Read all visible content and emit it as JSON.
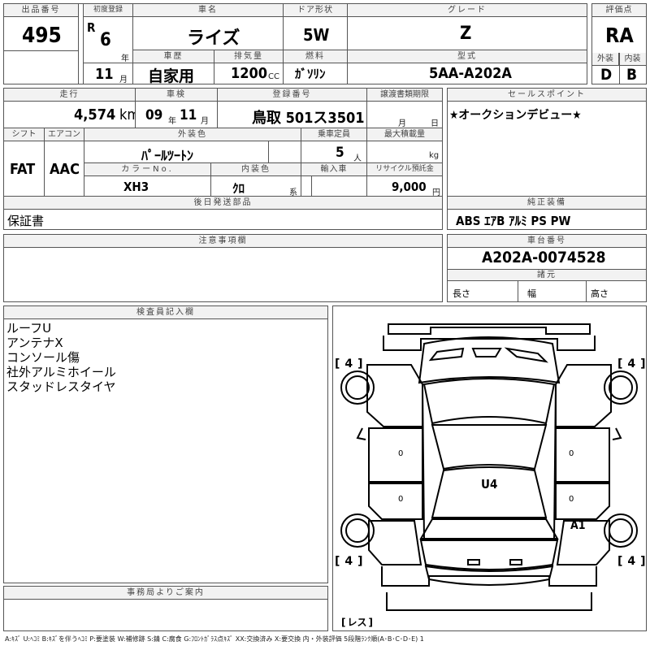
{
  "lot": {
    "label": "出品番号",
    "value": "495"
  },
  "reg": {
    "label": "初度登録",
    "era": "R",
    "year": "6",
    "year_unit": "年",
    "month": "11",
    "month_unit": "月"
  },
  "car_name": {
    "label": "車名",
    "value": "ライズ"
  },
  "door": {
    "label": "ドア形状",
    "value": "5W"
  },
  "grade": {
    "label": "グレード",
    "value": "Z"
  },
  "score": {
    "label": "評価点",
    "value": "RA"
  },
  "history": {
    "label": "車歴",
    "value": "自家用"
  },
  "displacement": {
    "label": "排気量",
    "value": "1200",
    "unit": "CC"
  },
  "fuel": {
    "label": "燃料",
    "value": "ｶﾞｿﾘﾝ"
  },
  "model": {
    "label": "型式",
    "value": "5AA-A202A"
  },
  "exterior_grade": {
    "label": "外装",
    "value": "D"
  },
  "interior_grade": {
    "label": "内装",
    "value": "B"
  },
  "mileage": {
    "label": "走行",
    "value": "4,574",
    "unit": "km"
  },
  "inspection": {
    "label": "車検",
    "year": "09",
    "year_unit": "年",
    "month": "11",
    "month_unit": "月"
  },
  "plate": {
    "label": "登録番号",
    "value": "鳥取 501ス3501"
  },
  "transfer": {
    "label": "譲渡書類期限",
    "month_unit": "月",
    "day_unit": "日"
  },
  "sales_point": {
    "label": "セールスポイント",
    "value": "★オークションデビュー★"
  },
  "shift": {
    "label": "シフト",
    "value": "FAT"
  },
  "aircon": {
    "label": "エアコン",
    "value": "AAC"
  },
  "ext_color": {
    "label": "外装色",
    "value": "ﾊﾟｰﾙﾂｰﾄﾝ"
  },
  "capacity": {
    "label": "乗車定員",
    "value": "5",
    "unit": "人"
  },
  "max_load": {
    "label": "最大積載量",
    "unit": "kg"
  },
  "color_no": {
    "label": "カラーNo.",
    "value": "XH3"
  },
  "int_color": {
    "label": "内装色",
    "value": "ｸﾛ",
    "unit": "系"
  },
  "import": {
    "label": "輸入車"
  },
  "recycle": {
    "label": "リサイクル預託金",
    "value": "9,000",
    "unit": "円"
  },
  "later_parts": {
    "label": "後日発送部品",
    "value": "保証書"
  },
  "equipment": {
    "label": "純正装備",
    "value": "ABS ｴｱB ｱﾙﾐ PS PW"
  },
  "notes": {
    "label": "注意事項欄"
  },
  "chassis": {
    "label": "車台番号",
    "value": "A202A-0074528"
  },
  "dims": {
    "label": "諸元",
    "length": "長さ",
    "width": "幅",
    "height": "高さ"
  },
  "inspector": {
    "label": "検査員記入欄",
    "lines": [
      "ルーフU",
      "アンテナX",
      "コンソール傷",
      "社外アルミホイール",
      "スタッドレスタイヤ"
    ]
  },
  "office": {
    "label": "事務局よりご案内"
  },
  "diagram": {
    "tire_fl": "4",
    "tire_fr": "4",
    "tire_rl": "4",
    "tire_rr": "4",
    "spare": "レス",
    "roof_mark": "U4",
    "side_mark": "A1",
    "zero_mark": "0"
  },
  "legend": "A:ｷｽﾞ U:ﾍｺﾐ B:ｷｽﾞを伴うﾍｺﾐ P:要塗装 W:補修跡 S:錆 C:腐食 G:ﾌﾛﾝﾄｶﾞﾗｽ点ｷｽﾞ XX:交換済み X:要交換 内・外装評価 5段階ﾗﾝｸ順(A･B･C･D･E) 1"
}
